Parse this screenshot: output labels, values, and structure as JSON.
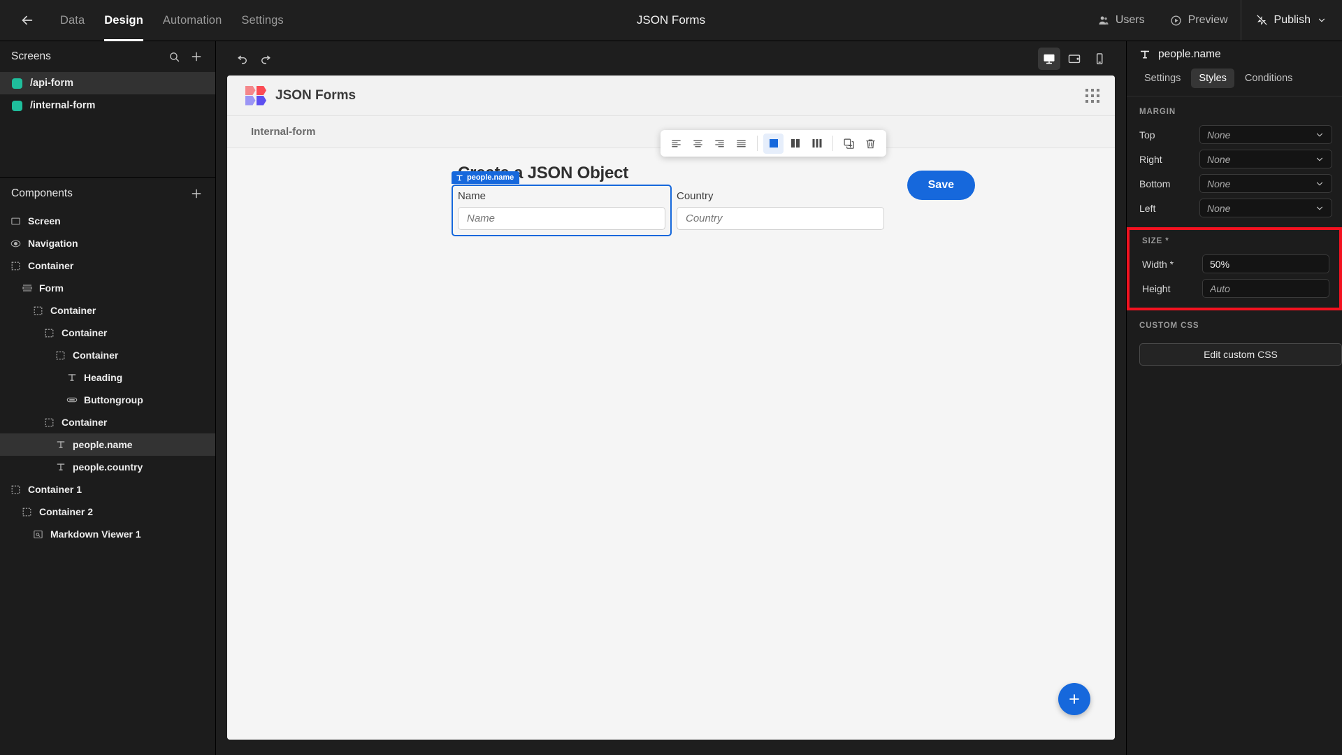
{
  "topbar": {
    "back_icon": "arrow-left-icon",
    "tabs": [
      {
        "label": "Data",
        "active": false
      },
      {
        "label": "Design",
        "active": true
      },
      {
        "label": "Automation",
        "active": false
      },
      {
        "label": "Settings",
        "active": false
      }
    ],
    "title": "JSON Forms",
    "users_label": "Users",
    "preview_label": "Preview",
    "publish_label": "Publish"
  },
  "left": {
    "screens_title": "Screens",
    "screens": [
      {
        "label": "/api-form",
        "active": true,
        "color": "#1fbe9c"
      },
      {
        "label": "/internal-form",
        "active": false,
        "color": "#1fbe9c"
      }
    ],
    "components_title": "Components",
    "tree": [
      {
        "label": "Screen",
        "icon": "screen-icon",
        "depth": 0,
        "selected": false
      },
      {
        "label": "Navigation",
        "icon": "navigation-icon",
        "depth": 0,
        "selected": false
      },
      {
        "label": "Container",
        "icon": "container-icon",
        "depth": 0,
        "selected": false
      },
      {
        "label": "Form",
        "icon": "form-icon",
        "depth": 1,
        "selected": false
      },
      {
        "label": "Container",
        "icon": "container-icon",
        "depth": 2,
        "selected": false
      },
      {
        "label": "Container",
        "icon": "container-icon",
        "depth": 3,
        "selected": false
      },
      {
        "label": "Container",
        "icon": "container-icon",
        "depth": 4,
        "selected": false
      },
      {
        "label": "Heading",
        "icon": "text-icon",
        "depth": 5,
        "selected": false
      },
      {
        "label": "Buttongroup",
        "icon": "buttongroup-icon",
        "depth": 5,
        "selected": false
      },
      {
        "label": "Container",
        "icon": "container-icon",
        "depth": 3,
        "selected": false
      },
      {
        "label": "people.name",
        "icon": "text-icon",
        "depth": 4,
        "selected": true
      },
      {
        "label": "people.country",
        "icon": "text-icon",
        "depth": 4,
        "selected": false
      },
      {
        "label": "Container 1",
        "icon": "container-icon",
        "depth": 0,
        "selected": false
      },
      {
        "label": "Container 2",
        "icon": "container-icon",
        "depth": 1,
        "selected": false
      },
      {
        "label": "Markdown Viewer 1",
        "icon": "markdown-viewer-icon",
        "depth": 2,
        "selected": false
      }
    ]
  },
  "center": {
    "undo_icon": "undo-icon",
    "redo_icon": "redo-icon",
    "devices": [
      {
        "name": "desktop",
        "active": true
      },
      {
        "name": "tablet",
        "active": false
      },
      {
        "name": "mobile",
        "active": false
      }
    ],
    "element_toolbar": [
      {
        "name": "align-left",
        "active": false
      },
      {
        "name": "align-center",
        "active": false
      },
      {
        "name": "align-right",
        "active": false
      },
      {
        "name": "align-justify",
        "active": false
      },
      {
        "name": "columns-one",
        "active": true
      },
      {
        "name": "columns-two",
        "active": false
      },
      {
        "name": "columns-three",
        "active": false
      },
      {
        "name": "duplicate",
        "active": false
      },
      {
        "name": "delete",
        "active": false
      }
    ]
  },
  "canvas": {
    "logo_text": "JSON Forms",
    "breadcrumb": "Internal-form",
    "form_title": "Create a JSON Object",
    "save_label": "Save",
    "selected_badge": "people.name",
    "fields": [
      {
        "label": "Name",
        "placeholder": "Name",
        "value": "",
        "selected": true
      },
      {
        "label": "Country",
        "placeholder": "Country",
        "value": "",
        "selected": false
      }
    ],
    "fab_label": "+"
  },
  "right": {
    "component_name": "people.name",
    "tabs": [
      {
        "label": "Settings",
        "active": false
      },
      {
        "label": "Styles",
        "active": true
      },
      {
        "label": "Conditions",
        "active": false
      }
    ],
    "margin_title": "MARGIN",
    "margin": [
      {
        "label": "Top",
        "value": "None"
      },
      {
        "label": "Right",
        "value": "None"
      },
      {
        "label": "Bottom",
        "value": "None"
      },
      {
        "label": "Left",
        "value": "None"
      }
    ],
    "size_title": "SIZE *",
    "size": [
      {
        "label": "Width *",
        "value": "50%",
        "placeholder": "Auto",
        "is_placeholder": false
      },
      {
        "label": "Height",
        "value": "",
        "placeholder": "Auto",
        "is_placeholder": true
      }
    ],
    "highlight_color": "#f31220",
    "custom_css_title": "CUSTOM CSS",
    "edit_css_label": "Edit custom CSS"
  }
}
